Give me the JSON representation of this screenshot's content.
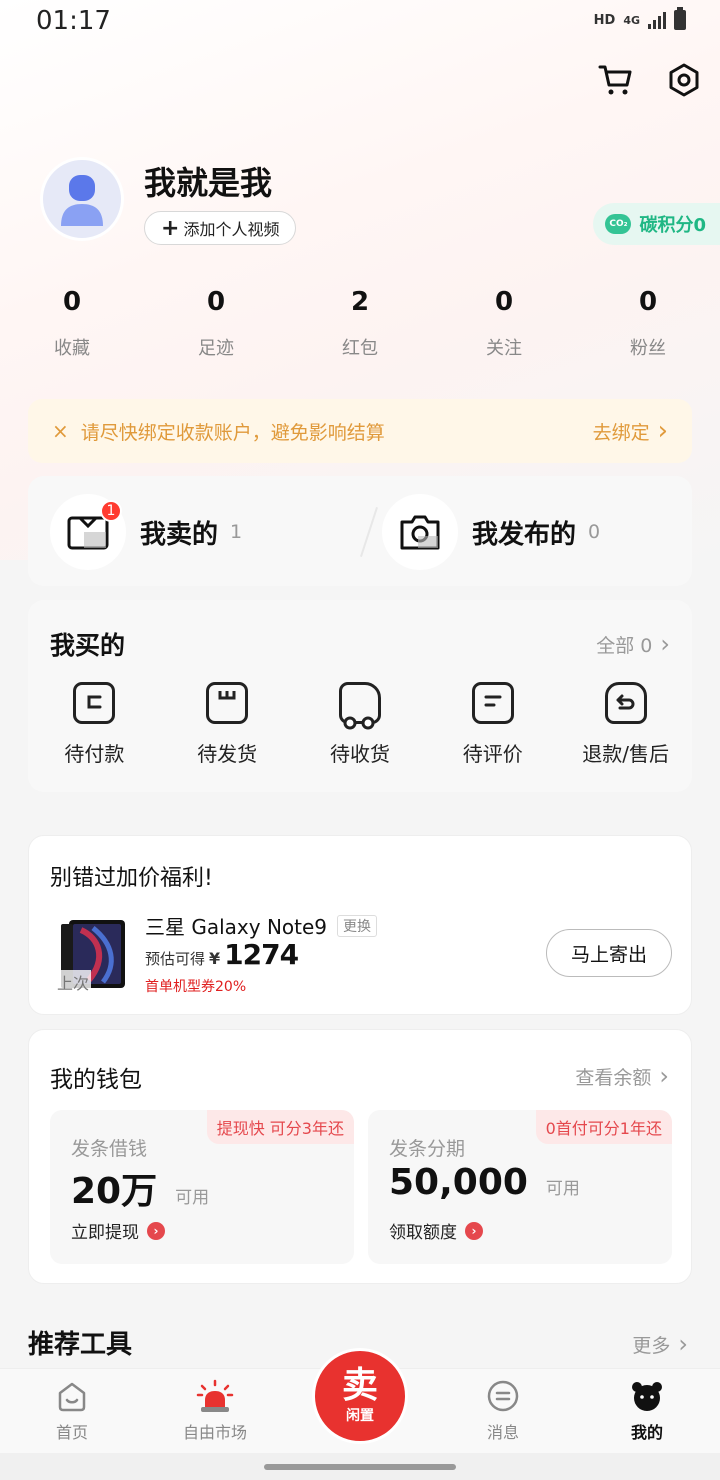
{
  "status": {
    "time": "01:17",
    "hd": "HD",
    "net": "4G"
  },
  "header": {
    "cart_icon": "cart-icon",
    "settings_icon": "settings-icon"
  },
  "profile": {
    "name": "我就是我",
    "add_video_plus": "+",
    "add_video": "添加个人视频",
    "carbon_badge": "CO₂",
    "carbon_label": "碳积分0"
  },
  "stats": [
    {
      "value": "0",
      "label": "收藏"
    },
    {
      "value": "0",
      "label": "足迹"
    },
    {
      "value": "2",
      "label": "红包"
    },
    {
      "value": "0",
      "label": "关注"
    },
    {
      "value": "0",
      "label": "粉丝"
    }
  ],
  "notice": {
    "close": "×",
    "message": "请尽快绑定收款账户，避免影响结算",
    "action": "去绑定",
    "chevron": "›"
  },
  "sell_publish": {
    "sold": {
      "title": "我卖的",
      "count": "1",
      "badge": "1"
    },
    "published": {
      "title": "我发布的",
      "count": "0"
    }
  },
  "bought": {
    "title": "我买的",
    "all_link": "全部 0",
    "chevron": "›",
    "items": [
      {
        "label": "待付款",
        "icon": "wallet-icon"
      },
      {
        "label": "待发货",
        "icon": "box-icon"
      },
      {
        "label": "待收货",
        "icon": "truck-icon"
      },
      {
        "label": "待评价",
        "icon": "review-icon"
      },
      {
        "label": "退款/售后",
        "icon": "refund-icon"
      }
    ]
  },
  "promo": {
    "title": "别错过加价福利!",
    "last_time": "上次",
    "product": "三星 Galaxy Note9",
    "change": "更换",
    "estimate_label": "预估可得",
    "currency": "¥",
    "price": "1274",
    "coupon": "首单机型券20%",
    "ship_button": "马上寄出"
  },
  "wallet": {
    "title": "我的钱包",
    "balance_link": "查看余额",
    "chevron": "›",
    "loan": {
      "tag": "提现快 可分3年还",
      "name": "发条借钱",
      "amount": "20万",
      "unit": "可用",
      "action": "立即提现",
      "arrow": "›"
    },
    "installment": {
      "tag": "0首付可分1年还",
      "name": "发条分期",
      "amount": "50,000",
      "unit": "可用",
      "action": "领取额度",
      "arrow": "›"
    }
  },
  "tools": {
    "title": "推荐工具",
    "more": "更多",
    "chevron": "›"
  },
  "tabbar": {
    "home": "首页",
    "market": "自由市场",
    "sell_big": "卖",
    "sell_small": "闲置",
    "messages": "消息",
    "mine": "我的"
  },
  "colors": {
    "accent_red": "#e8322f",
    "notice_text": "#e09a3b",
    "carbon_green": "#1fb784"
  }
}
